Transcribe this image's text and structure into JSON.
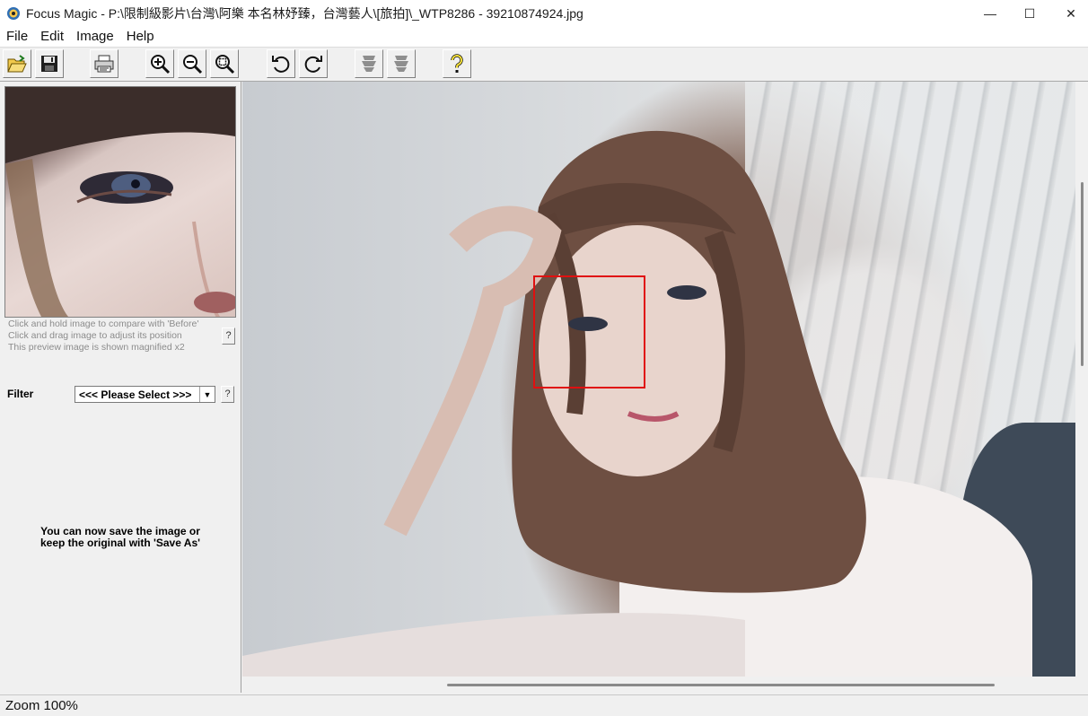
{
  "window": {
    "title": "Focus Magic - P:\\限制級影片\\台灣\\阿樂 本名林妤臻，台灣藝人\\[旅拍]\\_WTP8286 - 39210874924.jpg",
    "minimize_glyph": "—",
    "maximize_glyph": "☐",
    "close_glyph": "✕"
  },
  "menu": {
    "items": [
      "File",
      "Edit",
      "Image",
      "Help"
    ]
  },
  "toolbar": {
    "buttons": [
      {
        "name": "open-icon"
      },
      {
        "name": "save-icon"
      },
      {
        "name": "print-icon"
      },
      {
        "name": "zoom-in-icon"
      },
      {
        "name": "zoom-out-icon"
      },
      {
        "name": "zoom-fit-icon"
      },
      {
        "name": "rotate-left-icon"
      },
      {
        "name": "rotate-right-icon"
      },
      {
        "name": "focus-before-icon"
      },
      {
        "name": "focus-after-icon"
      },
      {
        "name": "help-icon"
      }
    ]
  },
  "preview": {
    "hints": [
      "Click and hold image to compare with 'Before'",
      "Click and drag image to adjust its position",
      "This preview image is shown magnified x2"
    ],
    "help_label": "?"
  },
  "filter": {
    "label": "Filter",
    "selected": "<<< Please Select >>>",
    "arrow": "▼",
    "help_label": "?"
  },
  "message": {
    "lines": [
      "You can now save the image or",
      "keep the original with 'Save As'"
    ]
  },
  "status": {
    "text": "Zoom 100%"
  },
  "colors": {
    "focus_rect": "#e01010",
    "background": "#f0f0f0"
  }
}
